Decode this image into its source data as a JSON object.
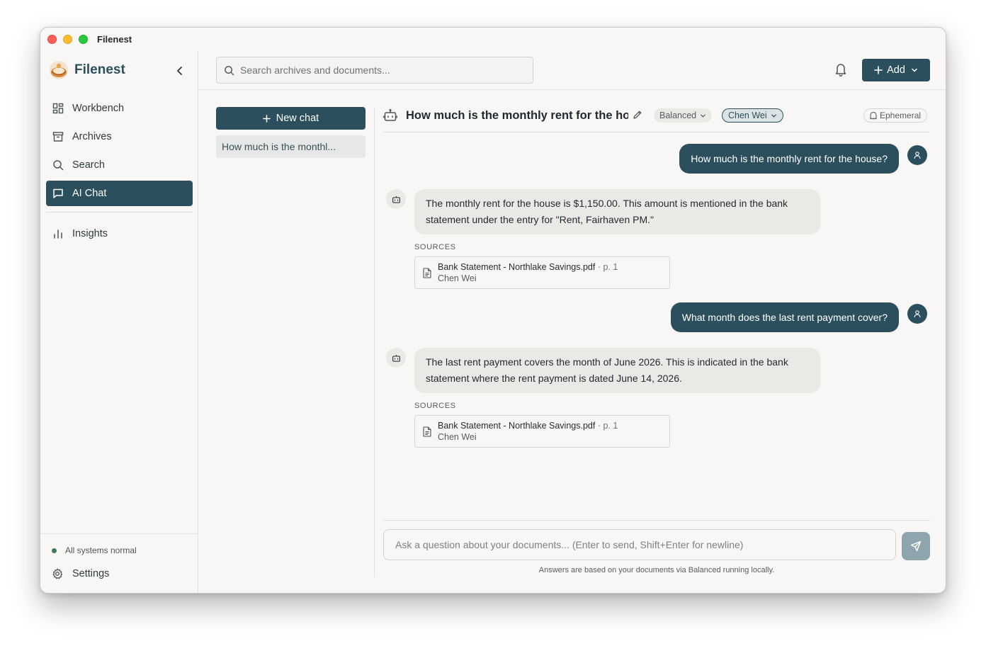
{
  "window": {
    "title": "Filenest"
  },
  "sidebar": {
    "brand": "Filenest",
    "items": [
      {
        "label": "Workbench",
        "icon": "grid-icon"
      },
      {
        "label": "Archives",
        "icon": "archive-icon"
      },
      {
        "label": "Search",
        "icon": "search-icon"
      },
      {
        "label": "AI Chat",
        "icon": "chat-icon",
        "active": true
      },
      {
        "label": "Insights",
        "icon": "bar-chart-icon"
      }
    ],
    "status": "All systems normal",
    "settings": "Settings"
  },
  "topbar": {
    "search_placeholder": "Search archives and documents...",
    "add_label": "Add"
  },
  "chatlist": {
    "new_chat": "New chat",
    "items": [
      "How much is the monthl..."
    ]
  },
  "chat": {
    "title": "How much is the monthly rent for the hou",
    "model": "Balanced",
    "user": "Chen Wei",
    "mode": "Ephemeral",
    "messages": [
      {
        "role": "user",
        "text": "How much is the monthly rent for the house?"
      },
      {
        "role": "assistant",
        "text": "The monthly rent for the house is $1,150.00. This amount is mentioned in the bank statement under the entry for \"Rent, Fairhaven PM.\"",
        "sources_label": "SOURCES",
        "source": {
          "name": "Bank Statement - Northlake Savings.pdf",
          "page": " · p. 1",
          "owner": "Chen Wei"
        }
      },
      {
        "role": "user",
        "text": "What month does the last rent payment cover?"
      },
      {
        "role": "assistant",
        "text": "The last rent payment covers the month of June 2026. This is indicated in the bank statement where the rent payment is dated June 14, 2026.",
        "sources_label": "SOURCES",
        "source": {
          "name": "Bank Statement - Northlake Savings.pdf",
          "page": " · p. 1",
          "owner": "Chen Wei"
        }
      }
    ],
    "composer_placeholder": "Ask a question about your documents... (Enter to send, Shift+Enter for newline)",
    "footnote": "Answers are based on your documents via Balanced running locally."
  },
  "colors": {
    "accent": "#2c4f5e",
    "status_ok": "#3d7a58",
    "send_disabled": "#8fa5ad"
  }
}
